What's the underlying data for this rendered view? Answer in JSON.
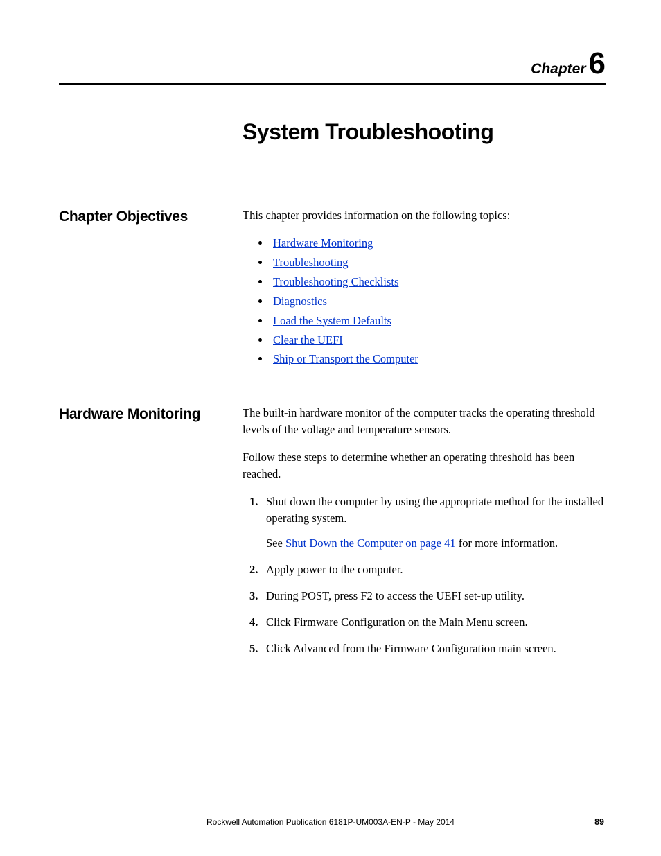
{
  "header": {
    "chapter_label": "Chapter",
    "chapter_number": "6"
  },
  "title": "System Troubleshooting",
  "sections": {
    "objectives": {
      "heading": "Chapter Objectives",
      "intro": "This chapter provides information on the following topics:",
      "topics": [
        "Hardware Monitoring",
        "Troubleshooting",
        "Troubleshooting Checklists",
        "Diagnostics",
        "Load the System Defaults",
        "Clear the UEFI",
        "Ship or Transport the Computer"
      ]
    },
    "hardware_monitoring": {
      "heading": "Hardware Monitoring",
      "para1": "The built-in hardware monitor of the computer tracks the operating threshold levels of the voltage and temperature sensors.",
      "para2": "Follow these steps to determine whether an operating threshold has been reached.",
      "steps": [
        {
          "text": "Shut down the computer by using the appropriate method for the installed operating system.",
          "sub_prefix": "See ",
          "sub_link": "Shut Down the Computer on page 41",
          "sub_suffix": " for more information."
        },
        {
          "text": "Apply power to the computer."
        },
        {
          "text": "During POST, press F2 to access the UEFI set-up utility."
        },
        {
          "text": "Click Firmware Configuration on the Main Menu screen."
        },
        {
          "text": "Click Advanced from the Firmware Configuration main screen."
        }
      ]
    }
  },
  "footer": {
    "publication": "Rockwell Automation Publication 6181P-UM003A-EN-P - May 2014",
    "page_number": "89"
  }
}
